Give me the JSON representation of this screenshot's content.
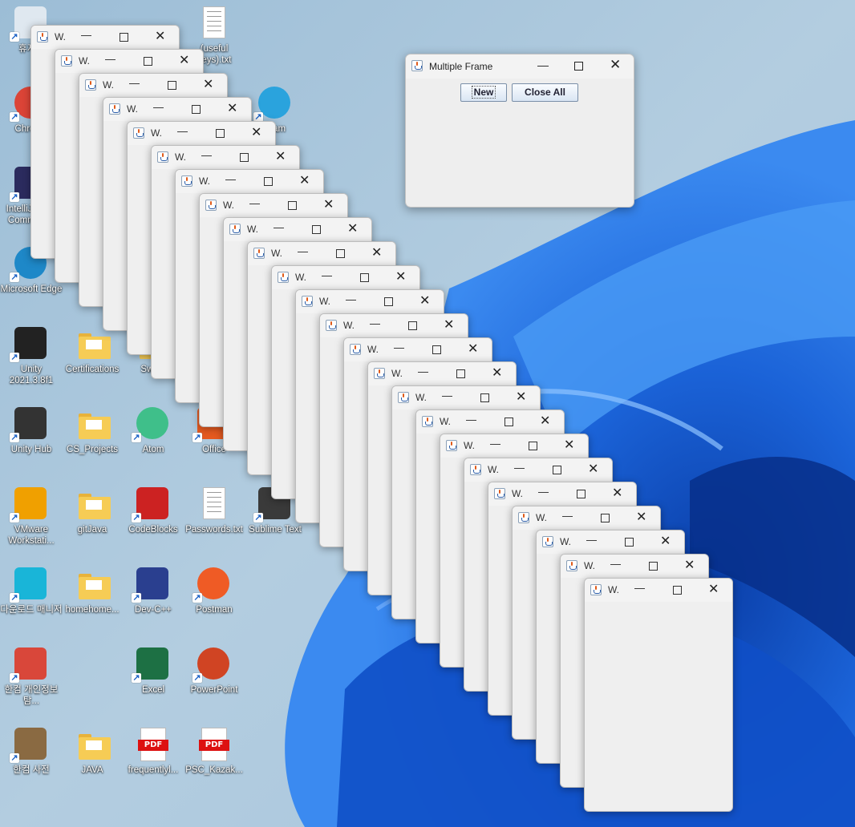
{
  "desktop": {
    "icons": [
      {
        "label": "휴지통",
        "icon": "recycle-bin-icon"
      },
      {
        "label": "Chrome",
        "icon": "chrome-icon"
      },
      {
        "label": "IntelliJ IDEA Community",
        "icon": "intellij-icon"
      },
      {
        "label": "Microsoft Edge",
        "icon": "edge-icon"
      },
      {
        "label": "Unity 2021.3.8f1",
        "icon": "unity-icon"
      },
      {
        "label": "Unity Hub",
        "icon": "unity-hub-icon"
      },
      {
        "label": "VMware Workstati...",
        "icon": "vmware-icon"
      },
      {
        "label": "다운로드 매니저",
        "icon": "download-manager-icon"
      },
      {
        "label": "한컴 개인정보탐...",
        "icon": "hancom-privacy-icon"
      },
      {
        "label": "한컴 사전",
        "icon": "hancom-dictionary-icon"
      },
      {
        "label": "Certifications",
        "icon": "folder-icon"
      },
      {
        "label": "CS_Projects",
        "icon": "folder-icon"
      },
      {
        "label": "gitJava",
        "icon": "folder-icon"
      },
      {
        "label": "homehome...",
        "icon": "folder-icon"
      },
      {
        "label": "JAVA",
        "icon": "folder-icon"
      },
      {
        "label": "Atom",
        "icon": "atom-icon"
      },
      {
        "label": "CodeBlocks",
        "icon": "codeblocks-icon"
      },
      {
        "label": "Dev-C++",
        "icon": "devcpp-icon"
      },
      {
        "label": "Excel",
        "icon": "excel-icon"
      },
      {
        "label": "frequentlyl...",
        "icon": "pdf-icon"
      },
      {
        "label": "Office",
        "icon": "office-icon"
      },
      {
        "label": "Passwords.txt",
        "icon": "text-file-icon"
      },
      {
        "label": "Postman",
        "icon": "postman-icon"
      },
      {
        "label": "PowerPoint",
        "icon": "powerpoint-icon"
      },
      {
        "label": "PSC_Kazak...",
        "icon": "pdf-icon"
      },
      {
        "label": "Sublime Text",
        "icon": "sublime-icon"
      },
      {
        "label": "gram",
        "icon": "telegram-icon"
      },
      {
        "label": "(useful keys).txt",
        "icon": "text-file-icon"
      },
      {
        "label": "Swing",
        "icon": "folder-icon"
      }
    ]
  },
  "child_window": {
    "title": "W.",
    "count": 24,
    "minimize_glyph": "—",
    "close_glyph": "✕"
  },
  "main_window": {
    "title": "Multiple Frame",
    "minimize_glyph": "—",
    "close_glyph": "✕",
    "new_label": "New",
    "close_all_label": "Close All"
  },
  "colors": {
    "wallpaper_blue": "#1f6fe0",
    "wallpaper_light": "#a9c6dc",
    "button_border": "#7a8fa8"
  }
}
